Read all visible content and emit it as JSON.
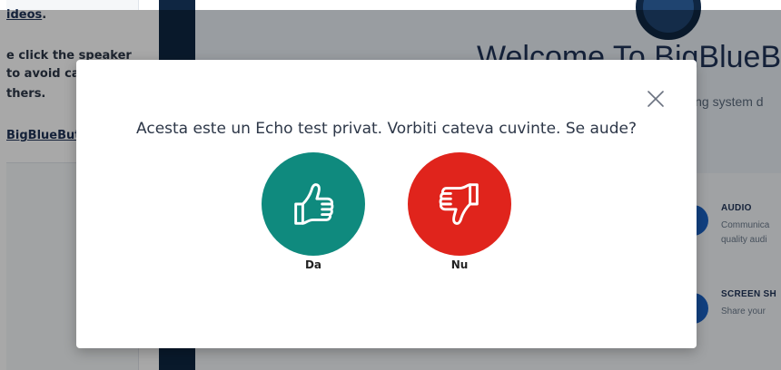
{
  "background": {
    "left_panel": {
      "line1": "ideos",
      "line1_suffix": ".",
      "line2": "e click the speaker",
      "line3": "to avoid ca",
      "line4": "thers.",
      "link": "BigBlueButt"
    },
    "welcome_title": "Welcome To BigBlueB",
    "welcome_subtitle": "ing system d",
    "features": [
      {
        "title": "AUDIO",
        "desc1": "Communica",
        "desc2": "quality audi"
      },
      {
        "title": "SCREEN SH",
        "desc1": "Share your",
        "desc2": ""
      }
    ]
  },
  "modal": {
    "question": "Acesta este un Echo test privat. Vorbiti cateva cuvinte. Se aude?",
    "yes_label": "Da",
    "no_label": "Nu",
    "close_icon": "close-icon",
    "yes_icon": "thumbs-up-icon",
    "no_icon": "thumbs-down-icon"
  },
  "colors": {
    "yes": "#0f8a7e",
    "no": "#e0241c",
    "overlay": "rgba(0,0,0,0.34)",
    "sidebar_dark": "#0f2642",
    "brand_blue": "#1b61c4"
  }
}
